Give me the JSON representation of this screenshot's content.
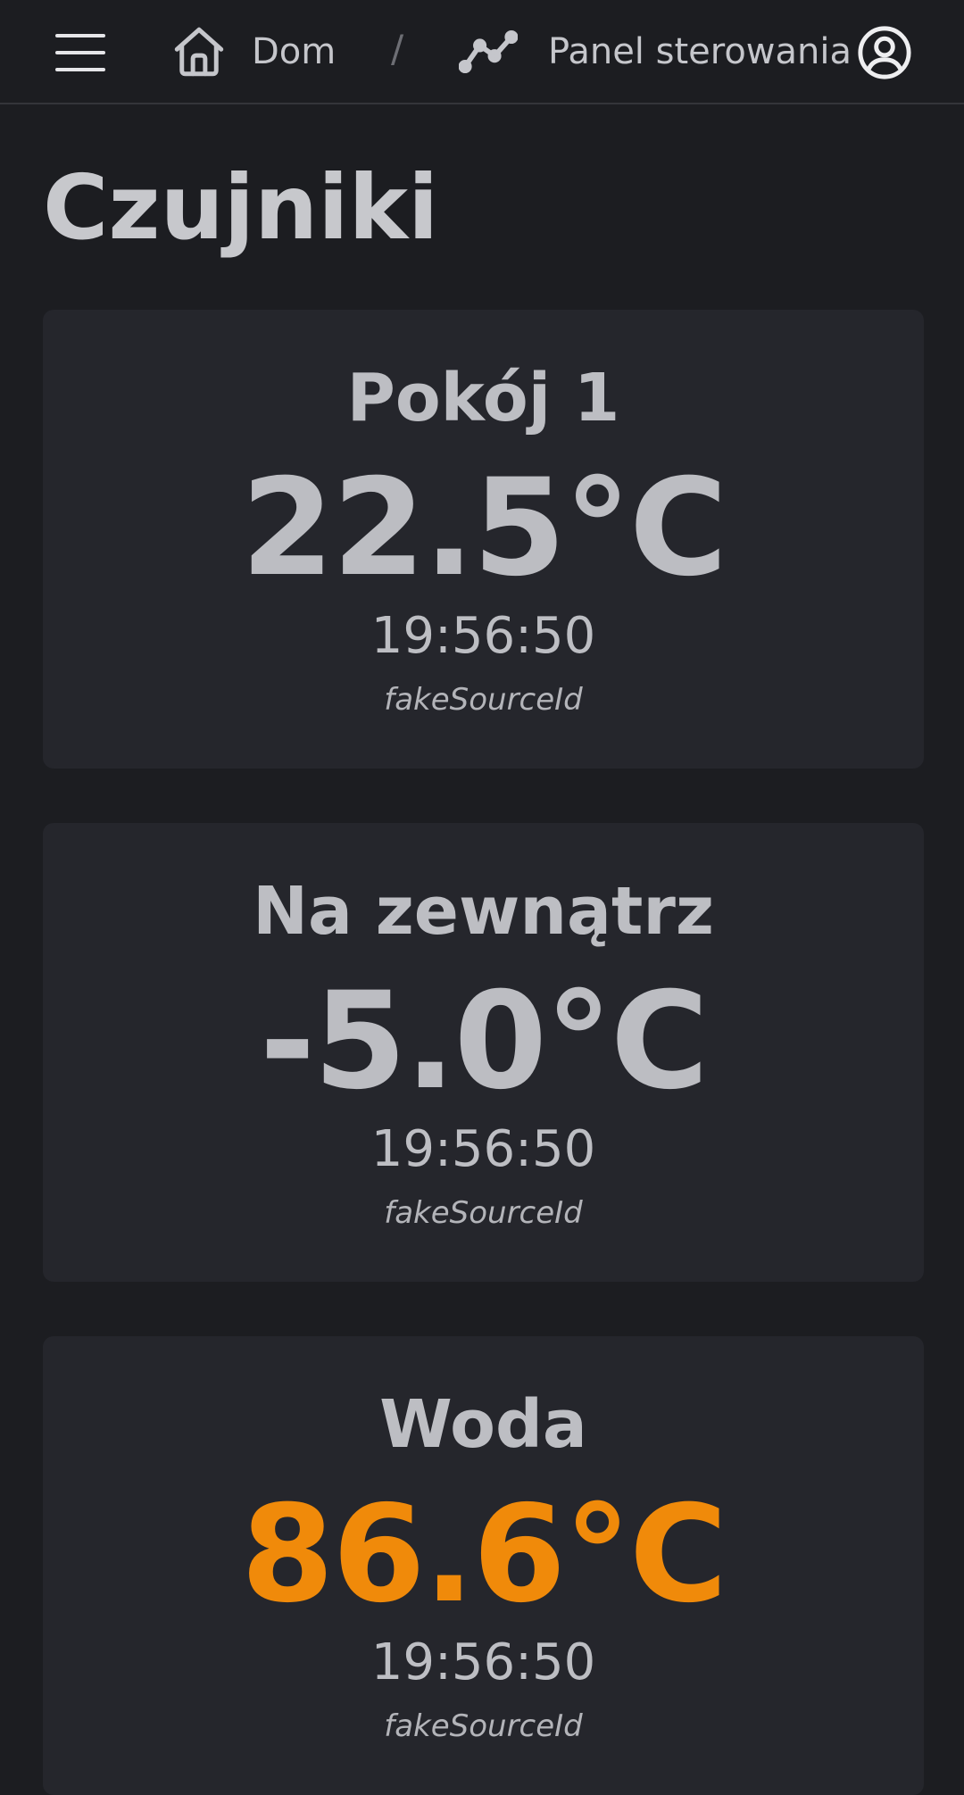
{
  "header": {
    "breadcrumb_home_label": "Dom",
    "breadcrumb_separator": "/",
    "breadcrumb_current_label": "Panel sterowania"
  },
  "page": {
    "title": "Czujniki"
  },
  "sensors": [
    {
      "name": "Pokój 1",
      "temperature": "22.5°C",
      "time": "19:56:50",
      "source": "fakeSourceId"
    },
    {
      "name": "Na zewnątrz",
      "temperature": "-5.0°C",
      "time": "19:56:50",
      "source": "fakeSourceId"
    },
    {
      "name": "Woda",
      "temperature": "86.6°C",
      "time": "19:56:50",
      "source": "fakeSourceId",
      "temperature_color": "#f08a0a"
    }
  ],
  "icons": {
    "menu": "hamburger-menu-icon",
    "home": "home-icon",
    "panel": "line-chart-icon",
    "account": "account-circle-icon"
  }
}
